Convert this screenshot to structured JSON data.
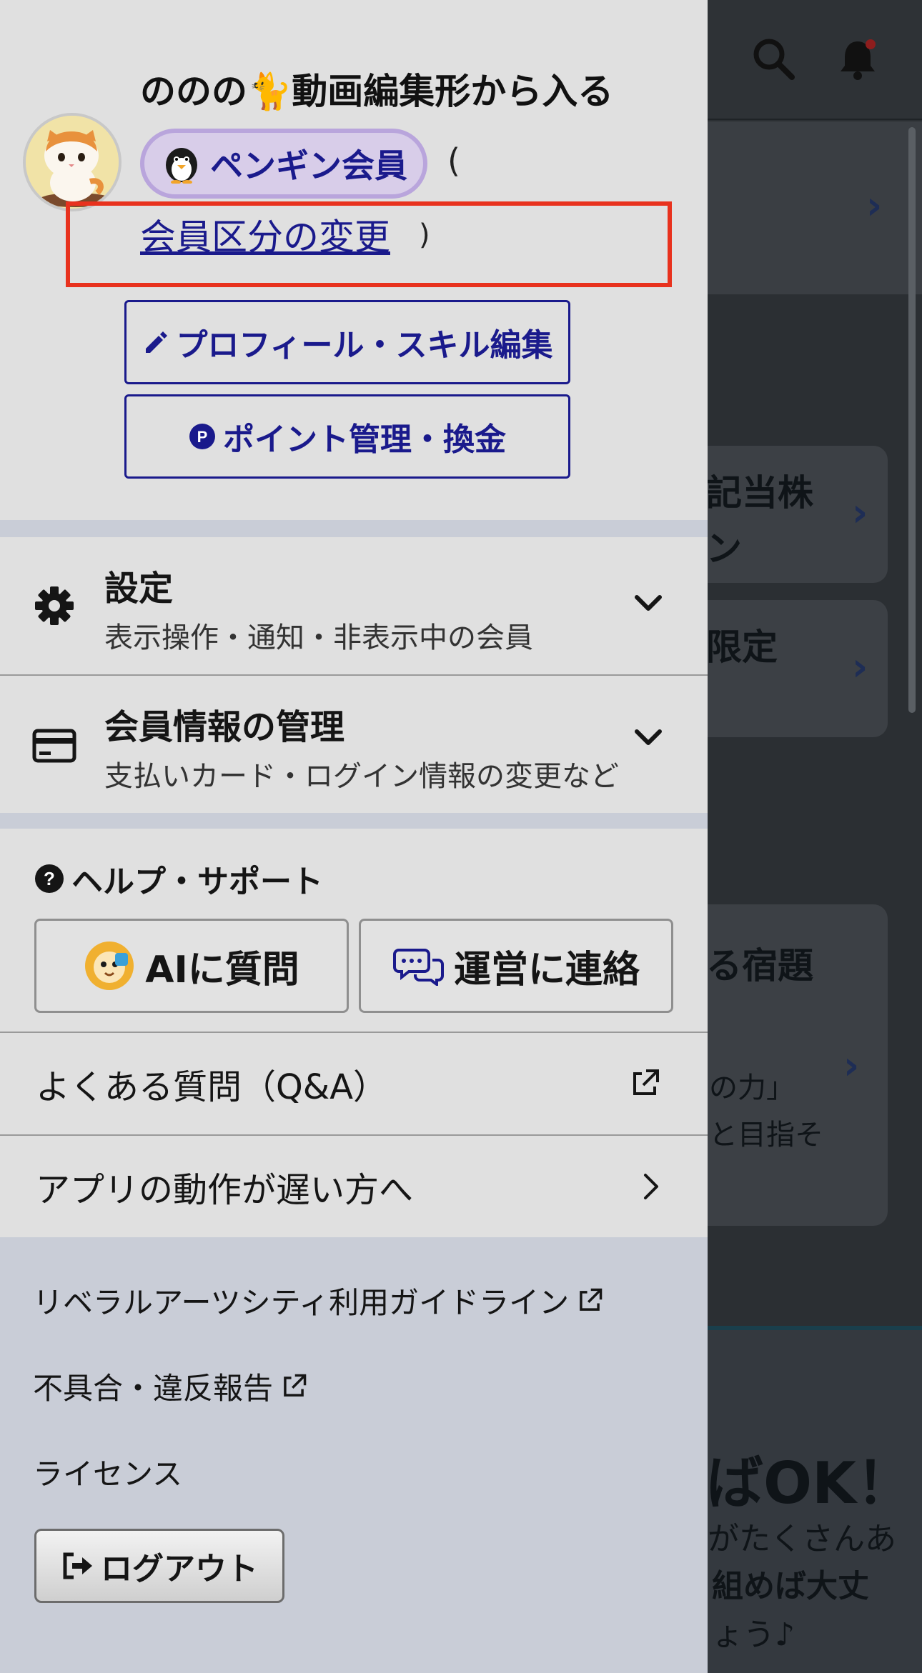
{
  "profile": {
    "username": "ののの🐈動画編集形から入る",
    "membership_badge": "ペンギン会員",
    "badge_icon": "penguin-icon",
    "paren_open": "(",
    "paren_close": ")",
    "change_membership_link": "会員区分の変更",
    "edit_profile_button": "プロフィール・スキル編集",
    "points_button": "ポイント管理・換金"
  },
  "menu": {
    "settings": {
      "title": "設定",
      "subtitle": "表示操作・通知・非表示中の会員"
    },
    "account": {
      "title": "会員情報の管理",
      "subtitle": "支払いカード・ログイン情報の変更など"
    }
  },
  "help": {
    "heading": "ヘルプ・サポート",
    "ask_ai_button": "AIに質問",
    "contact_button": "運営に連絡",
    "faq_link": "よくある質問（Q&A）",
    "slow_app_link": "アプリの動作が遅い方へ"
  },
  "footer": {
    "guidelines_link": "リベラルアーツシティ利用ガイドライン",
    "report_link": "不具合・違反報告",
    "license_link": "ライセンス",
    "logout_button": "ログアウト"
  },
  "background": {
    "card1_text": "記当株",
    "card1_text2": "ン",
    "card2_text": "限定",
    "card3_text": "る宿題",
    "card3_sub1": "の力」",
    "card3_sub2": "と目指そ",
    "banner_big": "ばOK！",
    "banner_line1": "がたくさんあ",
    "banner_line2": "組めば大丈",
    "banner_line3": "ょう♪"
  },
  "colors": {
    "accent_navy": "#1a1a8c",
    "highlight_red": "#e8321e",
    "badge_bg": "#d8cde9",
    "drawer_bg": "#e0e0e0",
    "footer_bg": "#c9cdd7"
  }
}
